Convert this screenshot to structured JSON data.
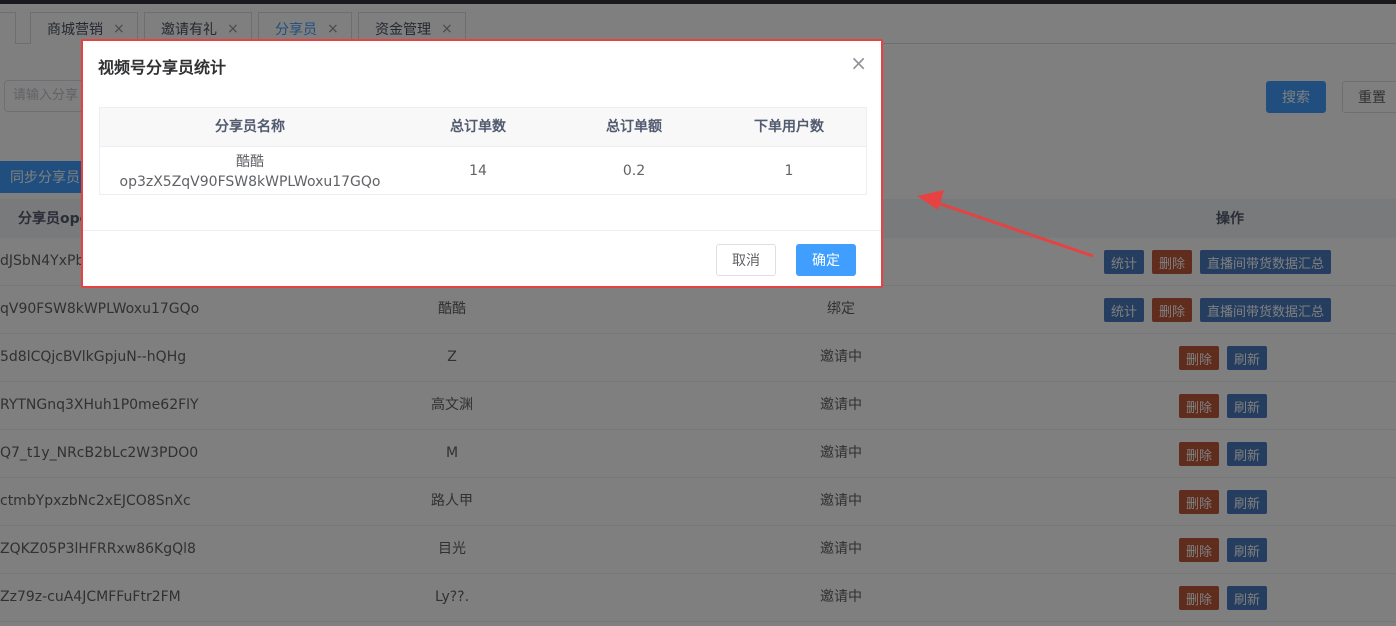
{
  "tabs": [
    {
      "label": "商城营销"
    },
    {
      "label": "邀请有礼"
    },
    {
      "label": "分享员"
    },
    {
      "label": "资金管理"
    }
  ],
  "tab_close_glyph": "×",
  "search": {
    "placeholder": "请输入分享",
    "search_label": "搜索",
    "reset_label": "重置"
  },
  "sync_label": "同步分享员",
  "table": {
    "headers": {
      "openid": "分享员ope",
      "actions": "操作"
    },
    "rows": [
      {
        "openid": "dJSbN4YxPbo",
        "name": "",
        "status": "",
        "ops": [
          "统计",
          "删除",
          "直播间带货数据汇总"
        ]
      },
      {
        "openid": "qV90FSW8kWPLWoxu17GQo",
        "name": "酷酷",
        "status": "绑定",
        "ops": [
          "统计",
          "删除",
          "直播间带货数据汇总"
        ]
      },
      {
        "openid": "5d8lCQjcBVlkGpjuN--hQHg",
        "name": "Z",
        "status": "邀请中",
        "ops": [
          "删除",
          "刷新"
        ]
      },
      {
        "openid": "RYTNGnq3XHuh1P0me62FlY",
        "name": "高文渊",
        "status": "邀请中",
        "ops": [
          "删除",
          "刷新"
        ]
      },
      {
        "openid": "Q7_t1y_NRcB2bLc2W3PDO0",
        "name": "M",
        "status": "邀请中",
        "ops": [
          "删除",
          "刷新"
        ]
      },
      {
        "openid": "ctmbYpxzbNc2xEJCO8SnXc",
        "name": "路人甲",
        "status": "邀请中",
        "ops": [
          "删除",
          "刷新"
        ]
      },
      {
        "openid": "ZQKZ05P3lHFRRxw86KgQl8",
        "name": "目光",
        "status": "邀请中",
        "ops": [
          "删除",
          "刷新"
        ]
      },
      {
        "openid": "Zz79z-cuA4JCMFFuFtr2FM",
        "name": "Ly??.",
        "status": "邀请中",
        "ops": [
          "删除",
          "刷新"
        ]
      }
    ]
  },
  "dialog": {
    "title": "视频号分享员统计",
    "close_glyph": "×",
    "headers": {
      "name": "分享员名称",
      "orders": "总订单数",
      "amount": "总订单额",
      "users": "下单用户数"
    },
    "row": {
      "name": "酷酷",
      "openid": "op3zX5ZqV90FSW8kWPLWoxu17GQo",
      "orders": "14",
      "amount": "0.2",
      "users": "1"
    },
    "cancel_label": "取消",
    "confirm_label": "确定"
  },
  "colors": {
    "primary": "#409eff",
    "danger_border": "#e64242",
    "annotation_arrow": "#e64242"
  }
}
